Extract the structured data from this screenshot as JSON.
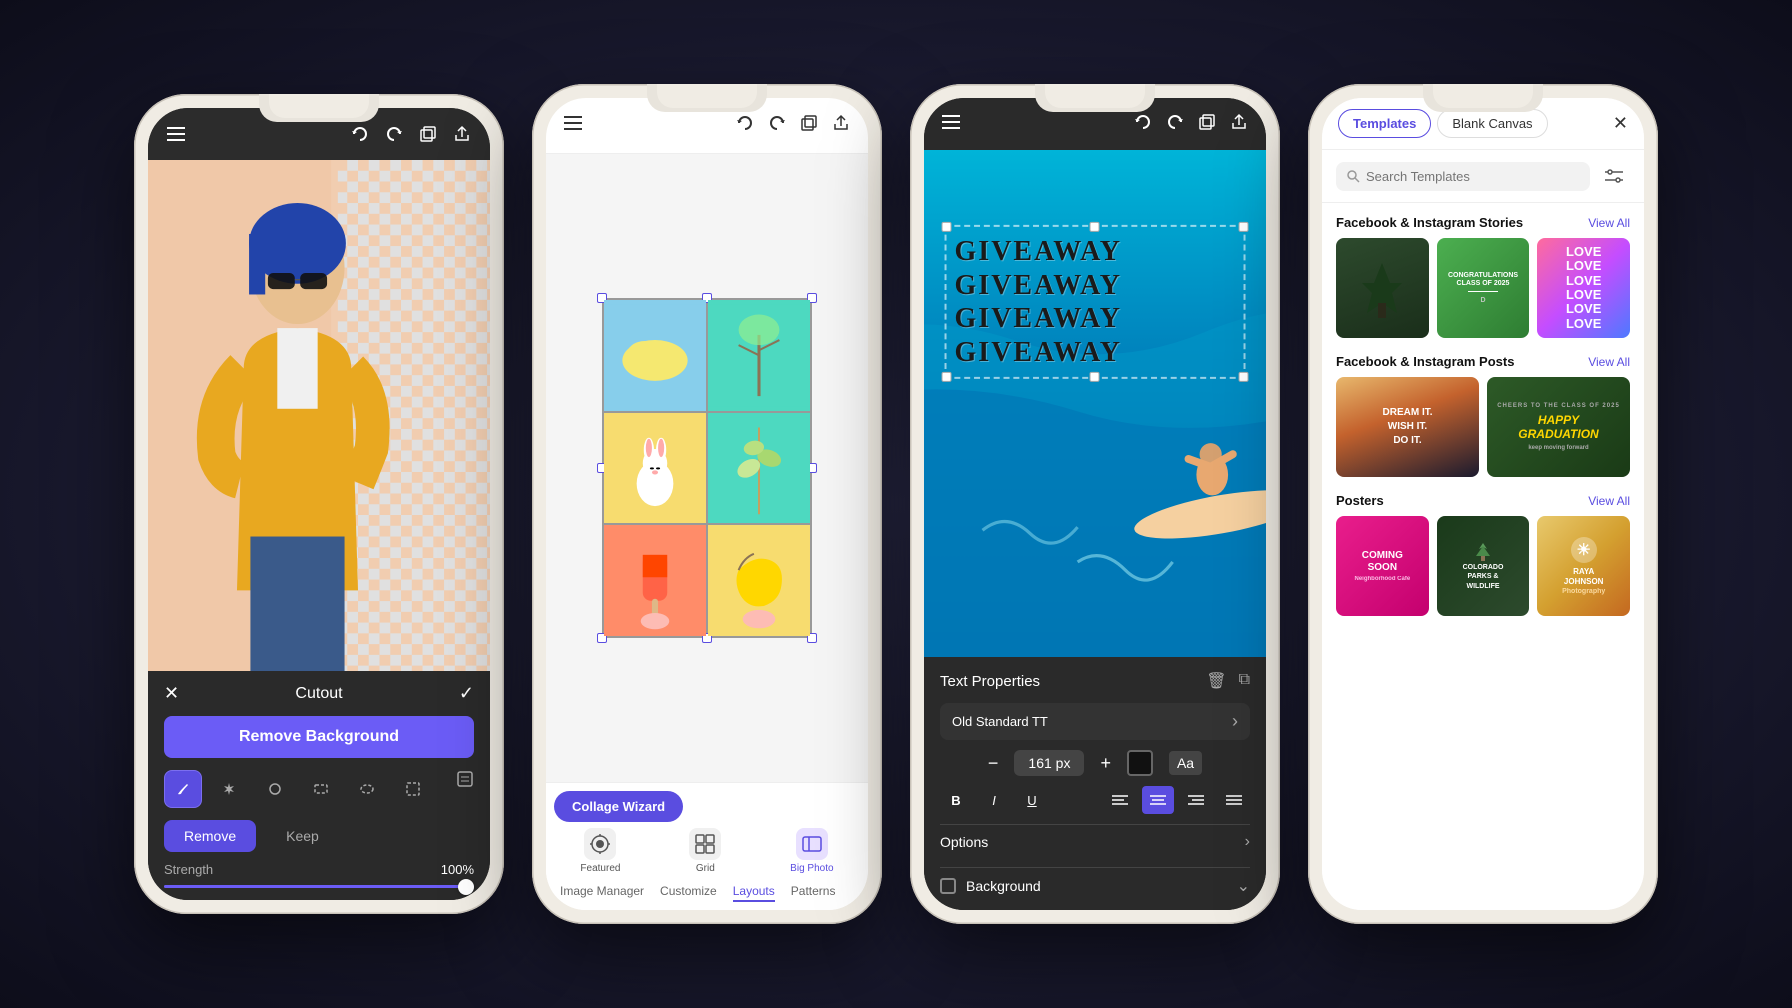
{
  "scene": {
    "bg": "#1a1a2e"
  },
  "phone1": {
    "title": "Cutout",
    "remove_bg_label": "Remove Background",
    "strength_label": "Strength",
    "strength_value": "100%",
    "remove_label": "Remove",
    "keep_label": "Keep",
    "tools": [
      "brush",
      "magic-wand",
      "lasso",
      "rect-select",
      "ellipse",
      "square-select"
    ]
  },
  "phone2": {
    "tabs": {
      "main_active": "Collage Wizard",
      "sub": [
        "Image Manager",
        "Customize",
        "Layouts",
        "Patterns"
      ],
      "active_sub": "Layouts",
      "icons": [
        "Featured",
        "Grid",
        "Big Photo"
      ]
    }
  },
  "phone3": {
    "giveaway_lines": [
      "GIVEAWAY",
      "GIVEAWAY",
      "GIVEAWAY",
      "GIVEAWAY"
    ],
    "panel": {
      "title": "Text Properties",
      "font": "Old Standard TT",
      "size": "161 px",
      "options_label": "Options",
      "bg_label": "Background"
    }
  },
  "phone4": {
    "tab_templates": "Templates",
    "tab_blank": "Blank Canvas",
    "search_placeholder": "Search Templates",
    "sections": [
      {
        "title": "Facebook & Instagram Stories",
        "view_all": "View All",
        "cards": [
          {
            "style": "forest",
            "main": "",
            "sub": ""
          },
          {
            "style": "congrats",
            "main": "Congratulations Class of 2025",
            "sub": ""
          },
          {
            "style": "love",
            "main": "LOVE LOVE LOVE",
            "sub": ""
          }
        ]
      },
      {
        "title": "Facebook & Instagram Posts",
        "view_all": "View All",
        "cards": [
          {
            "style": "mountain",
            "main": "DREAM IT. WISH IT. DO IT.",
            "sub": ""
          },
          {
            "style": "graduation",
            "main": "Happy Graduation",
            "sub": "Keep Moving Forward"
          }
        ]
      },
      {
        "title": "Posters",
        "view_all": "View All",
        "cards": [
          {
            "style": "coming",
            "main": "COMING SOON",
            "sub": ""
          },
          {
            "style": "parks",
            "main": "Colorado Parks & Wildlife",
            "sub": ""
          },
          {
            "style": "raya",
            "main": "Raya Johnson",
            "sub": ""
          }
        ]
      }
    ]
  }
}
